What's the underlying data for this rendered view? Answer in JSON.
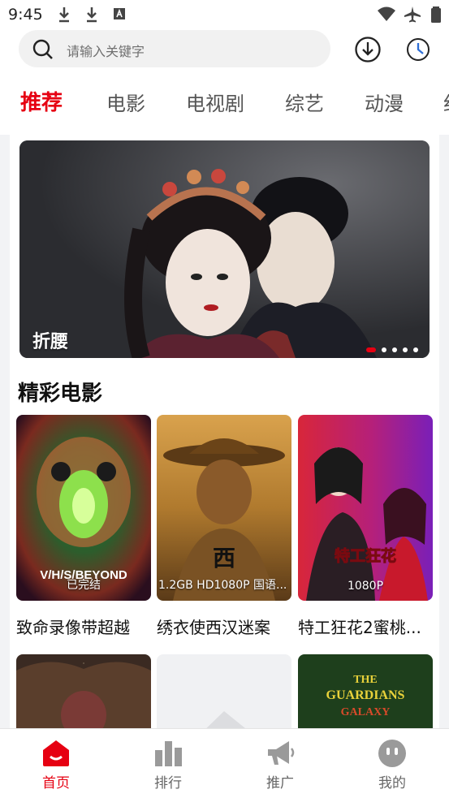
{
  "status_bar": {
    "time": "9:45"
  },
  "search": {
    "placeholder": "请输入关键字"
  },
  "tabs": [
    {
      "label": "推荐",
      "active": true
    },
    {
      "label": "电影"
    },
    {
      "label": "电视剧"
    },
    {
      "label": "综艺"
    },
    {
      "label": "动漫"
    },
    {
      "label": "纪"
    }
  ],
  "banner": {
    "title": "折腰",
    "slides": 5,
    "active_slide": 1
  },
  "section": {
    "title": "精彩电影"
  },
  "movies": [
    {
      "title": "致命录像带超越",
      "badge": "已完结",
      "poster_text": "V/H/S/BEYOND"
    },
    {
      "title": "绣衣使西汉迷案",
      "badge": "1.2GB HD1080P 国语..."
    },
    {
      "title": "特工狂花2蜜桃...",
      "badge": "1080P"
    }
  ],
  "bottom_nav": [
    {
      "label": "首页",
      "active": true
    },
    {
      "label": "排行"
    },
    {
      "label": "推广"
    },
    {
      "label": "我的"
    }
  ],
  "colors": {
    "accent": "#e60012"
  }
}
